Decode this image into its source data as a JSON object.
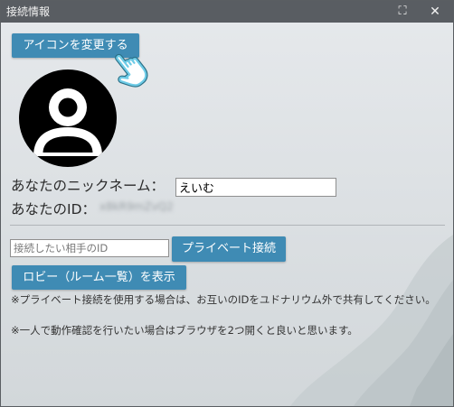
{
  "window": {
    "title": "接続情報",
    "maximize_glyph": "⛶",
    "close_glyph": "✕"
  },
  "profile": {
    "change_icon_label": "アイコンを変更する",
    "avatar_icon": "person-icon",
    "nickname_label": "あなたのニックネーム：",
    "nickname_value": "えいむ",
    "id_label": "あなたのID：",
    "id_value": "x8kR9mZvQ2"
  },
  "connection": {
    "peer_placeholder": "接続したい相手のID",
    "private_button_label": "プライベート接続",
    "lobby_button_label": "ロビー（ルーム一覧）を表示",
    "note_private": "※プライベート接続を使用する場合は、お互いのIDをユドナリウム外で共有してください。",
    "note_solo": "※一人で動作確認を行いたい場合はブラウザを2つ開くと良いと思います。"
  },
  "colors": {
    "titlebar": "#595d62",
    "button": "#3f8bb4",
    "button_text": "#ffffff",
    "cursor": "#6ecbe6"
  }
}
